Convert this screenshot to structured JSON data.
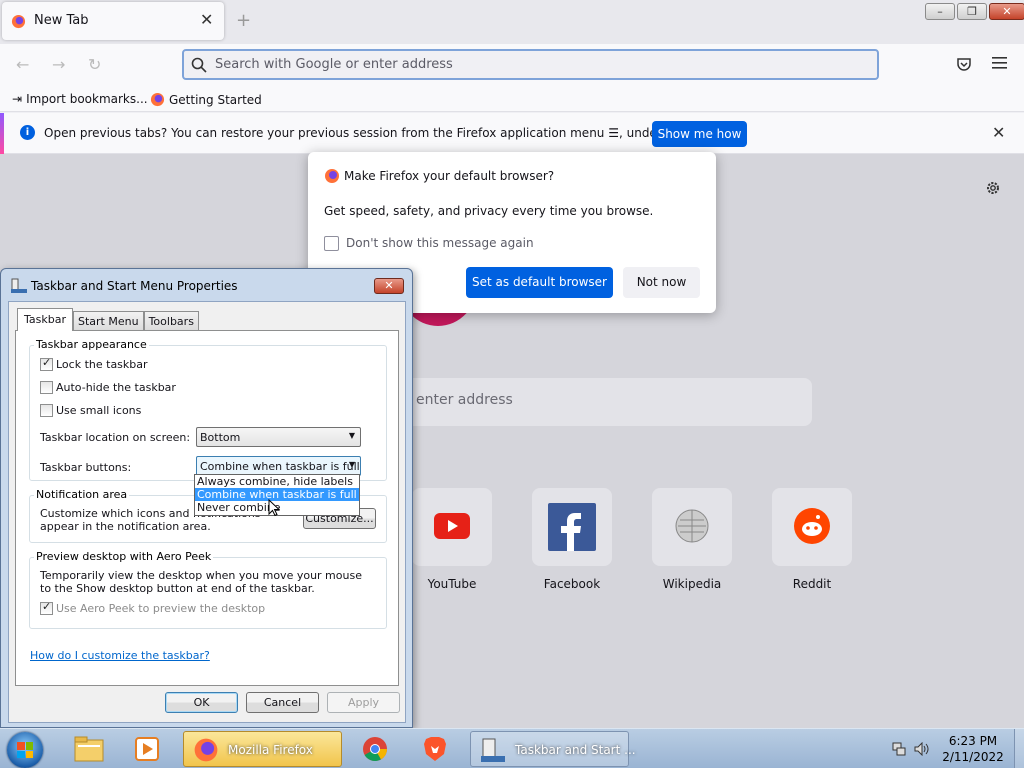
{
  "firefox": {
    "tab_title": "New Tab",
    "url_placeholder": "Search with Google or enter address",
    "bookmarks": [
      "Import bookmarks...",
      "Getting Started"
    ],
    "infobar": {
      "message": "Open previous tabs? You can restore your previous session from the Firefox application menu ☰, under History.",
      "button": "Show me how"
    },
    "content_search_placeholder": "enter address",
    "top_sites": [
      "YouTube",
      "Facebook",
      "Wikipedia",
      "Reddit"
    ],
    "default_dialog": {
      "title": "Make Firefox your default browser?",
      "body": "Get speed, safety, and privacy every time you browse.",
      "checkbox_label": "Don't show this message again",
      "primary_button": "Set as default browser",
      "secondary_button": "Not now"
    }
  },
  "taskbar_props": {
    "title": "Taskbar and Start Menu Properties",
    "tabs": [
      "Taskbar",
      "Start Menu",
      "Toolbars"
    ],
    "appearance": {
      "legend": "Taskbar appearance",
      "lock": "Lock the taskbar",
      "autohide": "Auto-hide the taskbar",
      "small_icons": "Use small icons",
      "location_label": "Taskbar location on screen:",
      "location_value": "Bottom",
      "buttons_label": "Taskbar buttons:",
      "buttons_value": "Combine when taskbar is full",
      "buttons_options": [
        "Always combine, hide labels",
        "Combine when taskbar is full",
        "Never combine"
      ]
    },
    "notification": {
      "legend": "Notification area",
      "text": "Customize which icons and notifications appear in the notification area.",
      "button": "Customize..."
    },
    "aero": {
      "legend": "Preview desktop with Aero Peek",
      "text": "Temporarily view the desktop when you move your mouse to the Show desktop button at end of the taskbar.",
      "checkbox": "Use Aero Peek to preview the desktop"
    },
    "help_link": "How do I customize the taskbar?",
    "ok": "OK",
    "cancel": "Cancel",
    "apply": "Apply"
  },
  "taskbar": {
    "firefox_label": "Mozilla Firefox",
    "props_label": "Taskbar and Start ...",
    "time": "6:23 PM",
    "date": "2/11/2022"
  }
}
